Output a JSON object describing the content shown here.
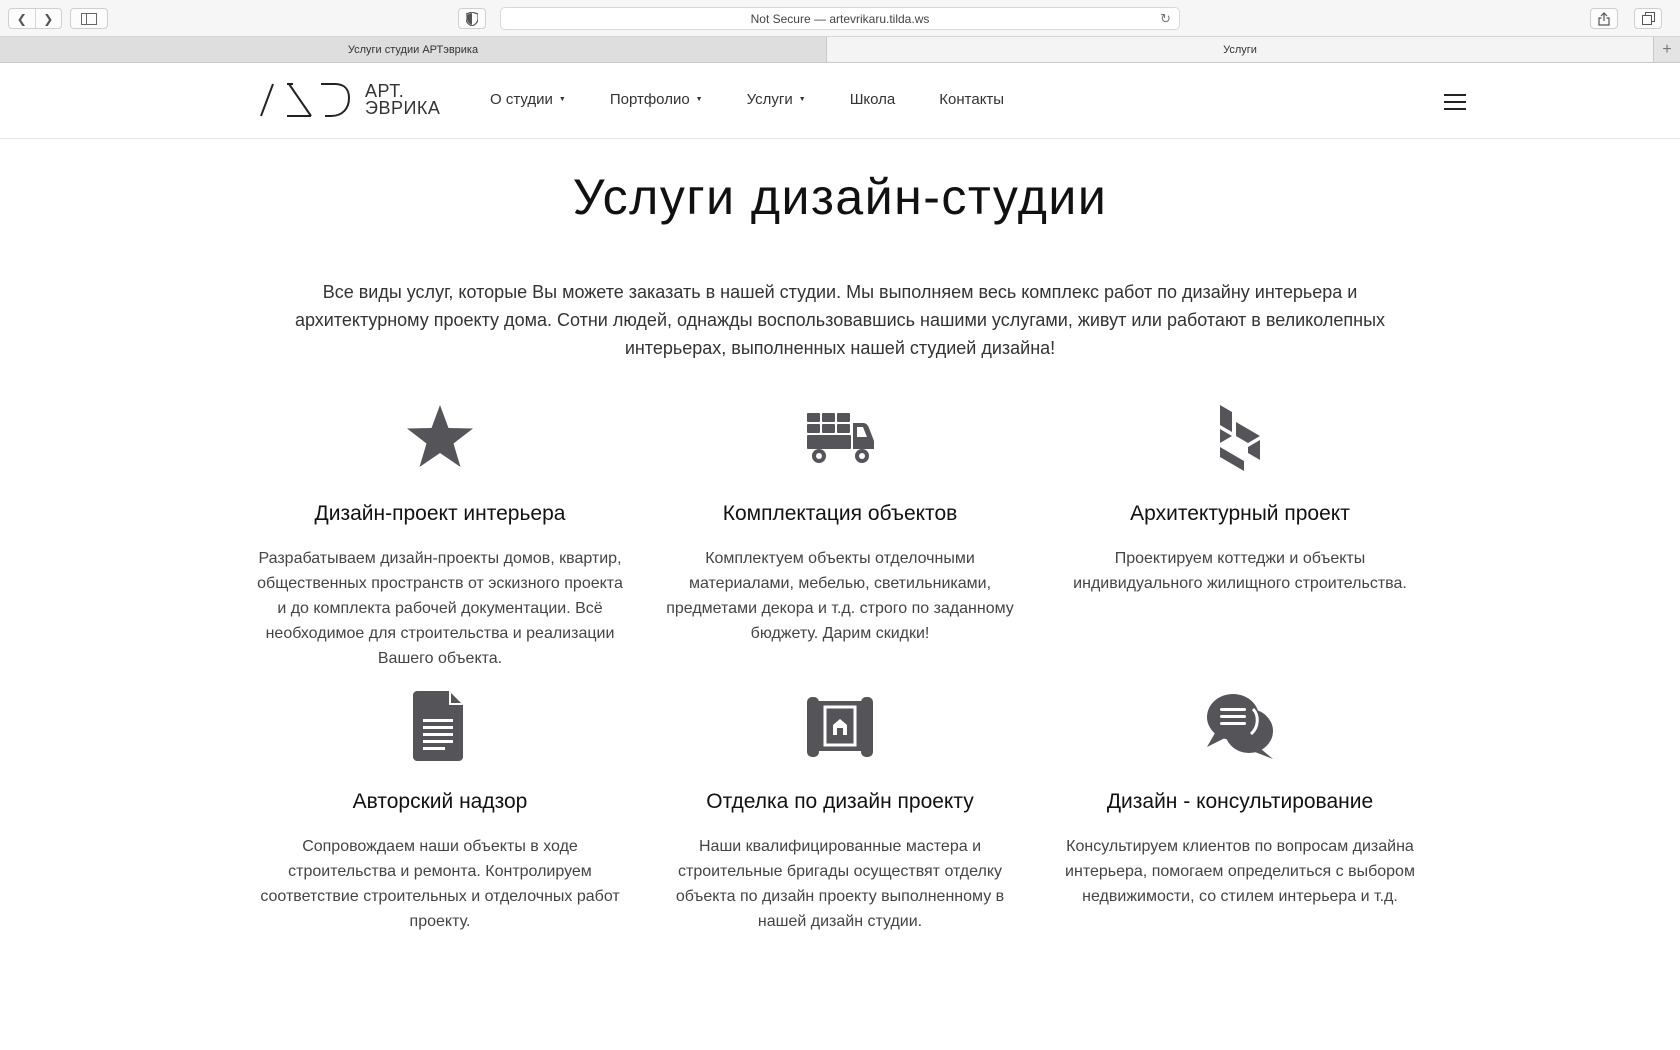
{
  "browser": {
    "address": "Not Secure — artevrikaru.tilda.ws",
    "tabs": [
      {
        "label": "Услуги студии АРТэврика"
      },
      {
        "label": "Услуги"
      }
    ]
  },
  "header": {
    "logo_line1": "АРТ.",
    "logo_line2": "ЭВРИКА",
    "menu": [
      {
        "label": "О студии"
      },
      {
        "label": "Портфолио"
      },
      {
        "label": "Услуги"
      },
      {
        "label": "Школа"
      },
      {
        "label": "Контакты"
      }
    ]
  },
  "main": {
    "title": "Услуги дизайн-студии",
    "intro": "Все виды услуг, которые Вы можете заказать в нашей студии. Мы выполняем весь комплекс работ по дизайну интерьера и архитектурному проекту дома. Сотни людей, однажды воспользовавшись нашими услугами, живут или работают в великолепных интерьерах, выполненных нашей студией дизайна!",
    "services": [
      {
        "icon": "star-icon",
        "title": "Дизайн-проект интерьера",
        "text": "Разрабатываем дизайн-проекты домов, квартир, общественных пространств от эскизного проекта и до комплекта рабочей документации. Всё необходимое для строительства и реализации Вашего объекта."
      },
      {
        "icon": "delivery-truck-icon",
        "title": "Комплектация объектов",
        "text": "Комплектуем объекты отделочными материалами, мебелью, светильниками, предметами декора и т.д. строго по заданному бюджету. Дарим скидки!"
      },
      {
        "icon": "houzz-icon",
        "title": "Архитектурный проект",
        "text": "Проектируем коттеджи и объекты индивидуального жилищного строительства."
      },
      {
        "icon": "document-icon",
        "title": "Авторский надзор",
        "text": "Сопровождаем наши объекты в ходе строительства и ремонта. Контролируем соответствие строительных и отделочных работ проекту."
      },
      {
        "icon": "blueprint-icon",
        "title": "Отделка по дизайн проекту",
        "text": "Наши квалифицированные мастера и строительные бригады осуществят отделку объекта по дизайн проекту выполненному в нашей дизайн студии."
      },
      {
        "icon": "chat-bubbles-icon",
        "title": "Дизайн - консультирование",
        "text": "Консультируем клиентов по вопросам дизайна интерьера, помогаем определиться с выбором недвижимости, со стилем интерьера и т.д."
      }
    ]
  }
}
